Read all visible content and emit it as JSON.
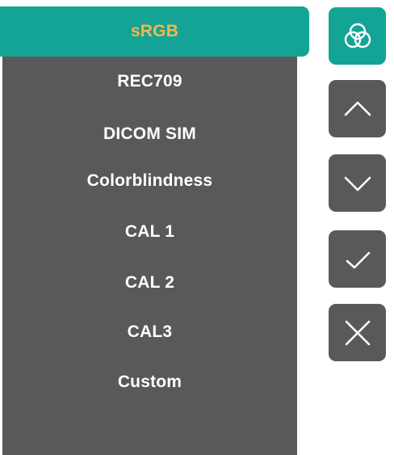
{
  "menu": {
    "items": [
      {
        "label": "sRGB",
        "selected": true
      },
      {
        "label": "REC709"
      },
      {
        "label": "DICOM SIM"
      },
      {
        "label": "Colorblindness"
      },
      {
        "label": "CAL 1"
      },
      {
        "label": "CAL 2"
      },
      {
        "label": "CAL3"
      },
      {
        "label": "Custom"
      }
    ]
  },
  "buttons": {
    "color_mode_icon": "color-circles-icon",
    "up_icon": "chevron-up-icon",
    "down_icon": "chevron-down-icon",
    "confirm_icon": "checkmark-icon",
    "close_icon": "close-icon"
  },
  "colors": {
    "accent": "#14a496",
    "panel": "#59595b",
    "selected_text": "#f0b94c",
    "text": "#ffffff"
  }
}
